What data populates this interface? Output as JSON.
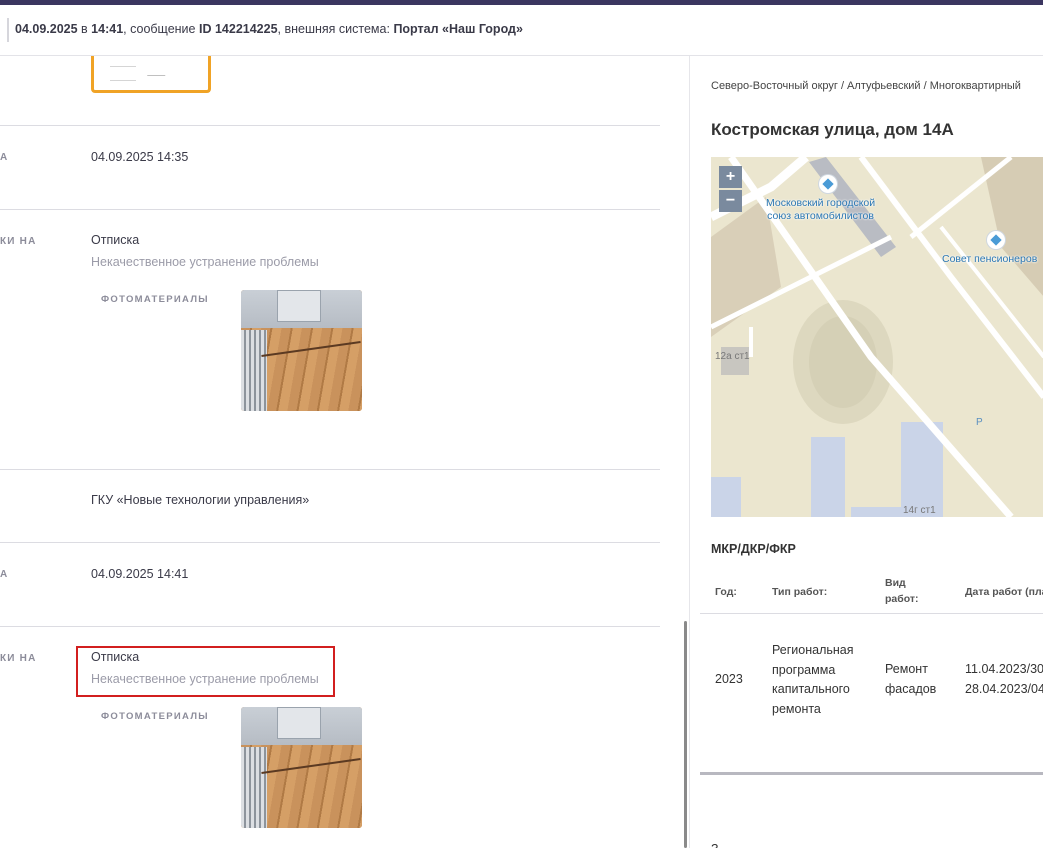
{
  "header": {
    "date": "04.09.2025",
    "in_word": "в",
    "time": "14:41",
    "message_label": ", сообщение",
    "message_id": "ID 142214225",
    "system_label": ", внешняя система:",
    "system_name": "Портал «Наш Город»"
  },
  "left": {
    "row1": {
      "label": "А",
      "value": "04.09.2025 14:35"
    },
    "row2": {
      "label": "КИ НА",
      "value": "Отписка",
      "sub": "Некачественное устранение проблемы",
      "photos_label": "ФОТОМАТЕРИАЛЫ"
    },
    "row3": {
      "value": "ГКУ «Новые технологии управления»"
    },
    "row4": {
      "label": "А",
      "value": "04.09.2025 14:41"
    },
    "row5": {
      "label": "КИ НА",
      "value": "Отписка",
      "sub": "Некачественное устранение проблемы",
      "photos_label": "ФОТОМАТЕРИАЛЫ"
    }
  },
  "right": {
    "breadcrumb": "Северо-Восточный округ / Алтуфьевский / Многоквартирный",
    "address": "Костромская улица, дом 14А",
    "map": {
      "zoom_in": "+",
      "zoom_out": "−",
      "label_1": "Московский городской\nсоюз автомобилистов",
      "label_2": "Совет пенсионеров",
      "bld_1": "12а ст1",
      "bld_2": "14г ст1",
      "parking": "P"
    },
    "section_title": "МКР/ДКР/ФКР",
    "table": {
      "headers": [
        "Год:",
        "Тип работ:",
        "Вид\nработ:",
        "Дата работ (пла"
      ],
      "row": {
        "year": "2023",
        "type": "Региональная\nпрограмма\nкапитального\nремонта",
        "kind": "Ремонт\nфасадов",
        "dates": "11.04.2023/30\n28.04.2023/04"
      }
    },
    "bottom_text": "З"
  }
}
